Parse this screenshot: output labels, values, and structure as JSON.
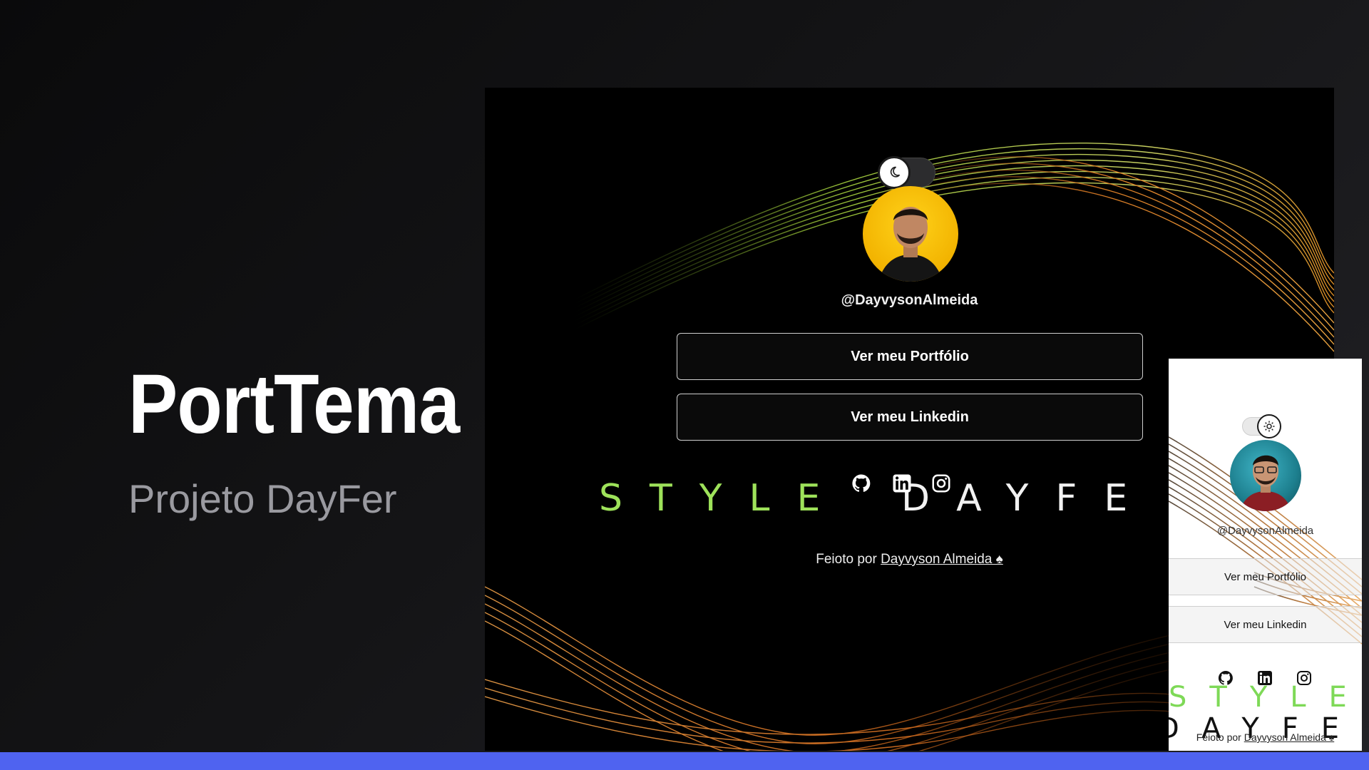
{
  "hero": {
    "title": "PortTema",
    "subtitle": "Projeto DayFer"
  },
  "desktop": {
    "theme": "dark",
    "theme_toggle_icon": "moon-icon",
    "avatar_icon": "avatar",
    "handle": "@DayvysonAlmeida",
    "buttons": [
      "Ver meu Portfólio",
      "Ver meu Linkedin"
    ],
    "brand_left": "STYLE",
    "brand_right": "DAYFE",
    "socials": [
      "github-icon",
      "linkedin-icon",
      "instagram-icon"
    ],
    "footer_prefix": "Feioto por",
    "footer_link": "Dayvyson Almeida ♠"
  },
  "mobile": {
    "theme": "light",
    "theme_toggle_icon": "sun-icon",
    "handle": "@DayvysonAlmeida",
    "buttons": [
      "Ver meu Portfólio",
      "Ver meu Linkedin"
    ],
    "brand_left": "STYLE",
    "brand_right": "DAYFER",
    "socials": [
      "github-icon",
      "linkedin-icon",
      "instagram-icon"
    ],
    "footer_prefix": "Feioto por",
    "footer_link": "Dayvyson Almeida ♠"
  },
  "colors": {
    "background": "#141416",
    "accent_bar": "#4f63f0",
    "brand_green": "#9ee25a",
    "wave_green": "#b8e04a",
    "wave_orange": "#f08a2a"
  }
}
